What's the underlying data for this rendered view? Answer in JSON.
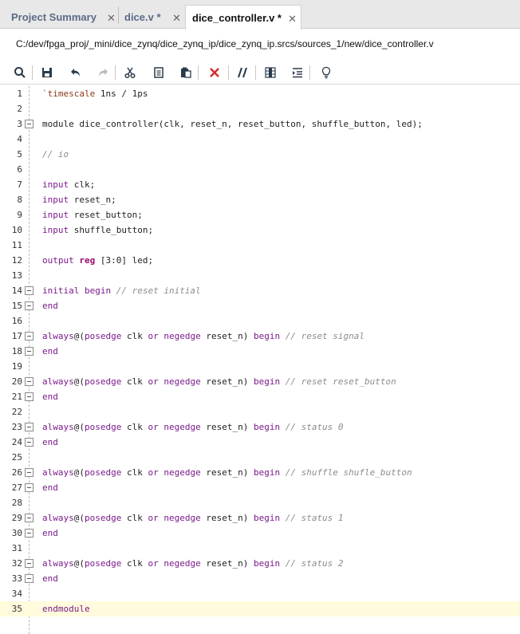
{
  "tabs": [
    {
      "label": "Project Summary",
      "close": "✕"
    },
    {
      "label": "dice.v *",
      "close": "✕"
    },
    {
      "label": "dice_controller.v *",
      "close": "✕"
    }
  ],
  "file_path": "C:/dev/fpga_proj/_mini/dice_zynq/dice_zynq_ip/dice_zynq_ip.srcs/sources_1/new/dice_controller.v",
  "toolbar": [
    "search-icon",
    "save-icon",
    "undo-icon",
    "redo-icon",
    "cut-icon",
    "copy-icon",
    "paste-icon",
    "delete-icon",
    "comment-icon",
    "column-select-icon",
    "indent-icon",
    "lightbulb-icon"
  ],
  "colors": {
    "keyword": "#7a1b8a",
    "reg_keyword": "#9b0c6e",
    "comment": "#8c8c8c",
    "current_line": "#fffbdc",
    "delete": "#d32f2f"
  },
  "lines": [
    {
      "n": "1",
      "parts": [
        [
          "dir",
          "`timescale"
        ],
        [
          "",
          " 1ns / 1ps"
        ]
      ]
    },
    {
      "n": "2",
      "parts": []
    },
    {
      "n": "3",
      "fold": "start",
      "parts": [
        [
          "",
          "module dice_controller(clk, reset_n, reset_button, shuffle_button, led);"
        ]
      ]
    },
    {
      "n": "4",
      "parts": []
    },
    {
      "n": "5",
      "parts": [
        [
          "cm",
          "// io"
        ]
      ]
    },
    {
      "n": "6",
      "parts": []
    },
    {
      "n": "7",
      "parts": [
        [
          "kw",
          "input"
        ],
        [
          "",
          " clk;"
        ]
      ]
    },
    {
      "n": "8",
      "parts": [
        [
          "kw",
          "input"
        ],
        [
          "",
          " reset_n;"
        ]
      ]
    },
    {
      "n": "9",
      "parts": [
        [
          "kw",
          "input"
        ],
        [
          "",
          " reset_button;"
        ]
      ]
    },
    {
      "n": "10",
      "parts": [
        [
          "kw",
          "input"
        ],
        [
          "",
          " shuffle_button;"
        ]
      ]
    },
    {
      "n": "11",
      "parts": []
    },
    {
      "n": "12",
      "parts": [
        [
          "kw",
          "output"
        ],
        [
          "",
          " "
        ],
        [
          "kw2",
          "reg"
        ],
        [
          "",
          " [3:0] led;"
        ]
      ]
    },
    {
      "n": "13",
      "parts": []
    },
    {
      "n": "14",
      "fold": "start",
      "parts": [
        [
          "kw",
          "initial begin"
        ],
        [
          "",
          " "
        ],
        [
          "cm",
          "// reset initial"
        ]
      ]
    },
    {
      "n": "15",
      "fold": "end",
      "parts": [
        [
          "kw",
          "end"
        ]
      ]
    },
    {
      "n": "16",
      "parts": []
    },
    {
      "n": "17",
      "fold": "start",
      "parts": [
        [
          "kw",
          "always"
        ],
        [
          "",
          "@("
        ],
        [
          "kw",
          "posedge"
        ],
        [
          "",
          " clk "
        ],
        [
          "kw",
          "or"
        ],
        [
          "",
          " "
        ],
        [
          "kw",
          "negedge"
        ],
        [
          "",
          " reset_n) "
        ],
        [
          "kw",
          "begin"
        ],
        [
          "",
          " "
        ],
        [
          "cm",
          "// reset signal"
        ]
      ]
    },
    {
      "n": "18",
      "fold": "end",
      "parts": [
        [
          "kw",
          "end"
        ]
      ]
    },
    {
      "n": "19",
      "parts": []
    },
    {
      "n": "20",
      "fold": "start",
      "parts": [
        [
          "kw",
          "always"
        ],
        [
          "",
          "@("
        ],
        [
          "kw",
          "posedge"
        ],
        [
          "",
          " clk "
        ],
        [
          "kw",
          "or"
        ],
        [
          "",
          " "
        ],
        [
          "kw",
          "negedge"
        ],
        [
          "",
          " reset_n) "
        ],
        [
          "kw",
          "begin"
        ],
        [
          "",
          " "
        ],
        [
          "cm",
          "// reset reset_button"
        ]
      ]
    },
    {
      "n": "21",
      "fold": "end",
      "parts": [
        [
          "kw",
          "end"
        ]
      ]
    },
    {
      "n": "22",
      "parts": []
    },
    {
      "n": "23",
      "fold": "start",
      "parts": [
        [
          "kw",
          "always"
        ],
        [
          "",
          "@("
        ],
        [
          "kw",
          "posedge"
        ],
        [
          "",
          " clk "
        ],
        [
          "kw",
          "or"
        ],
        [
          "",
          " "
        ],
        [
          "kw",
          "negedge"
        ],
        [
          "",
          " reset_n) "
        ],
        [
          "kw",
          "begin"
        ],
        [
          "",
          " "
        ],
        [
          "cm",
          "// status 0"
        ]
      ]
    },
    {
      "n": "24",
      "fold": "end",
      "parts": [
        [
          "kw",
          "end"
        ]
      ]
    },
    {
      "n": "25",
      "parts": []
    },
    {
      "n": "26",
      "fold": "start",
      "parts": [
        [
          "kw",
          "always"
        ],
        [
          "",
          "@("
        ],
        [
          "kw",
          "posedge"
        ],
        [
          "",
          " clk "
        ],
        [
          "kw",
          "or"
        ],
        [
          "",
          " "
        ],
        [
          "kw",
          "negedge"
        ],
        [
          "",
          " reset_n) "
        ],
        [
          "kw",
          "begin"
        ],
        [
          "",
          " "
        ],
        [
          "cm",
          "// shuffle shufle_button"
        ]
      ]
    },
    {
      "n": "27",
      "fold": "end",
      "parts": [
        [
          "kw",
          "end"
        ]
      ]
    },
    {
      "n": "28",
      "parts": []
    },
    {
      "n": "29",
      "fold": "start",
      "parts": [
        [
          "kw",
          "always"
        ],
        [
          "",
          "@("
        ],
        [
          "kw",
          "posedge"
        ],
        [
          "",
          " clk "
        ],
        [
          "kw",
          "or"
        ],
        [
          "",
          " "
        ],
        [
          "kw",
          "negedge"
        ],
        [
          "",
          " reset_n) "
        ],
        [
          "kw",
          "begin"
        ],
        [
          "",
          " "
        ],
        [
          "cm",
          "// status 1"
        ]
      ]
    },
    {
      "n": "30",
      "fold": "end",
      "parts": [
        [
          "kw",
          "end"
        ]
      ]
    },
    {
      "n": "31",
      "parts": []
    },
    {
      "n": "32",
      "fold": "start",
      "parts": [
        [
          "kw",
          "always"
        ],
        [
          "",
          "@("
        ],
        [
          "kw",
          "posedge"
        ],
        [
          "",
          " clk "
        ],
        [
          "kw",
          "or"
        ],
        [
          "",
          " "
        ],
        [
          "kw",
          "negedge"
        ],
        [
          "",
          " reset_n) "
        ],
        [
          "kw",
          "begin"
        ],
        [
          "",
          " "
        ],
        [
          "cm",
          "// status 2"
        ]
      ]
    },
    {
      "n": "33",
      "fold": "end",
      "parts": [
        [
          "kw",
          "end"
        ]
      ]
    },
    {
      "n": "34",
      "parts": []
    },
    {
      "n": "35",
      "current": true,
      "parts": [
        [
          "kw",
          "endmodule"
        ]
      ]
    }
  ]
}
